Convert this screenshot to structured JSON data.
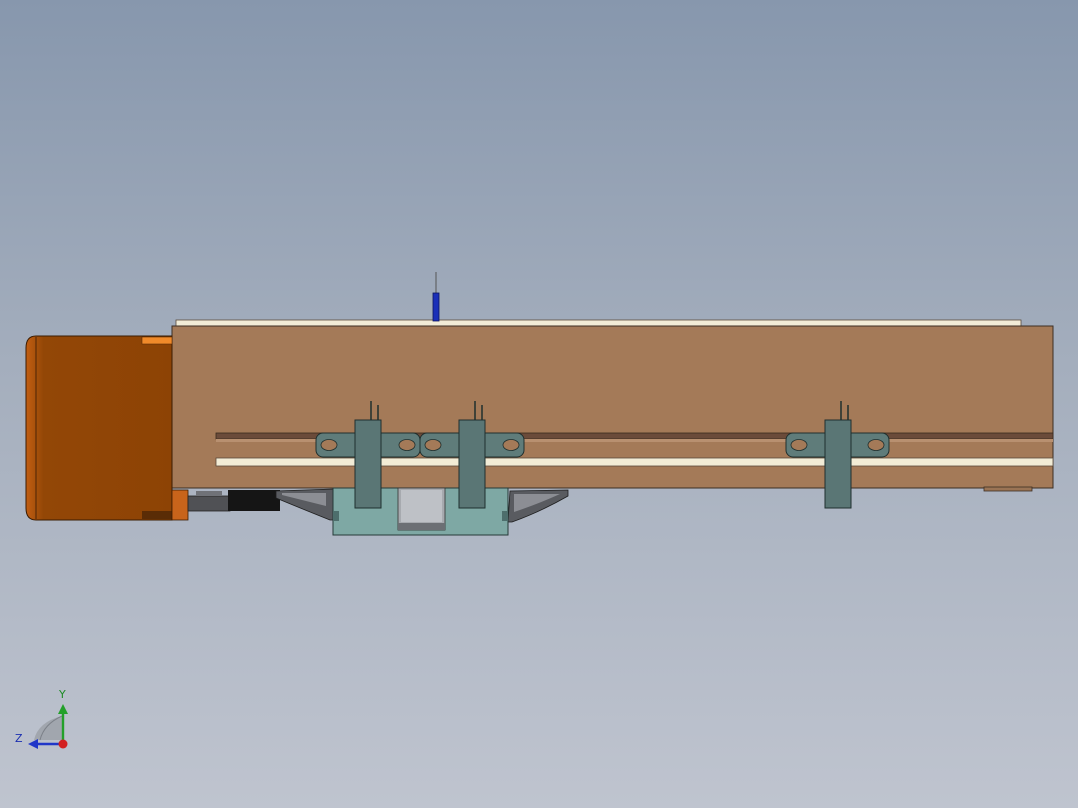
{
  "viewport": {
    "background_top": "#8797ad",
    "background_bottom": "#bfc4cf"
  },
  "model": {
    "colors": {
      "rail_body": "#a47a58",
      "motor_body": "#934706",
      "motor_accent": "#e27a22",
      "rail_top_strip": "#f0e9d2",
      "bracket": "#5a7675",
      "carriage": "#7ea8a4",
      "probe": "#1a2fb8"
    }
  },
  "triad": {
    "y_label": "Y",
    "z_label": "Z",
    "y_color": "#23a02a",
    "z_color": "#2137c8",
    "x_color": "#d32020"
  }
}
